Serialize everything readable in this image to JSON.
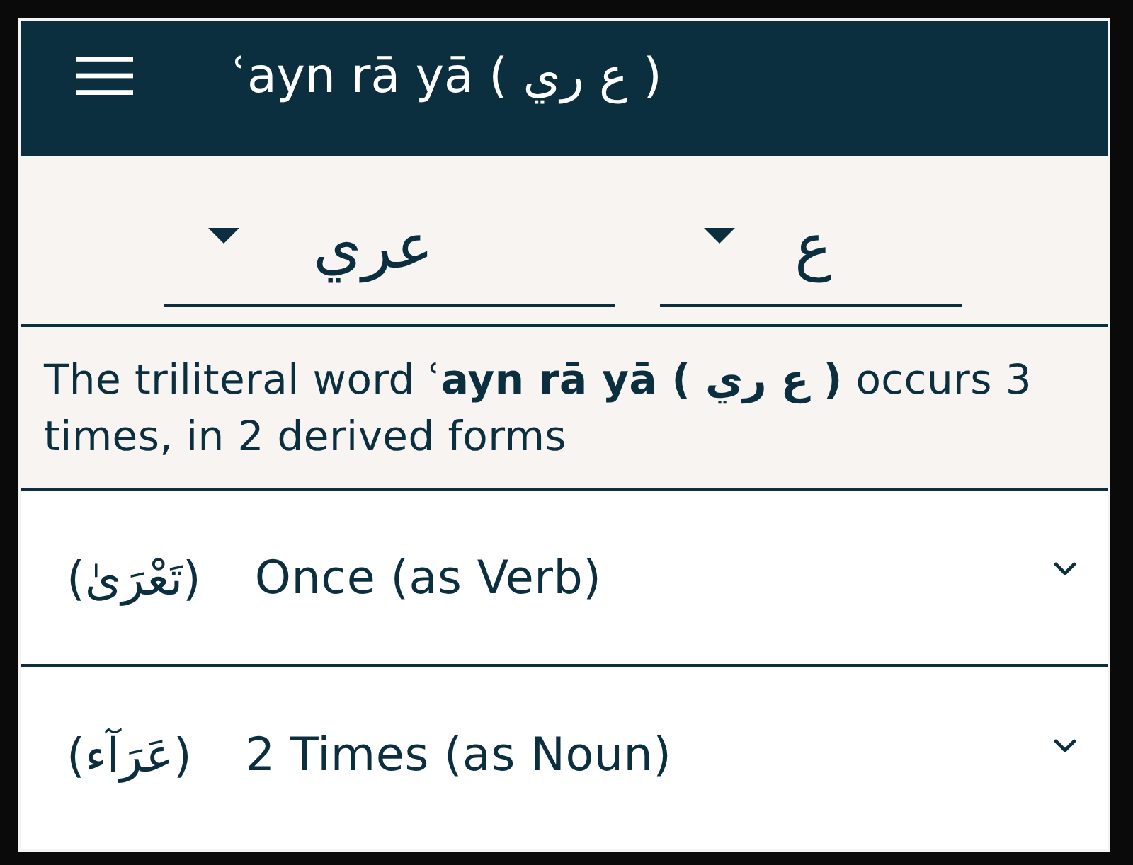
{
  "app_bar": {
    "title": "ʿayn rā yā ( ع ري )"
  },
  "filters": [
    {
      "value": "ع"
    },
    {
      "value": "عري"
    }
  ],
  "summary": "The triliteral word ʿ**ayn rā yā ( ع ري )** occurs 3 times, in 2 derived forms",
  "forms": [
    {
      "arabic": "(تَعْرَىٰ)",
      "label": "Once (as Verb)",
      "expanded": false
    },
    {
      "arabic": "(عَرَآء)",
      "label": "2 Times (as Noun)",
      "expanded": false
    }
  ]
}
